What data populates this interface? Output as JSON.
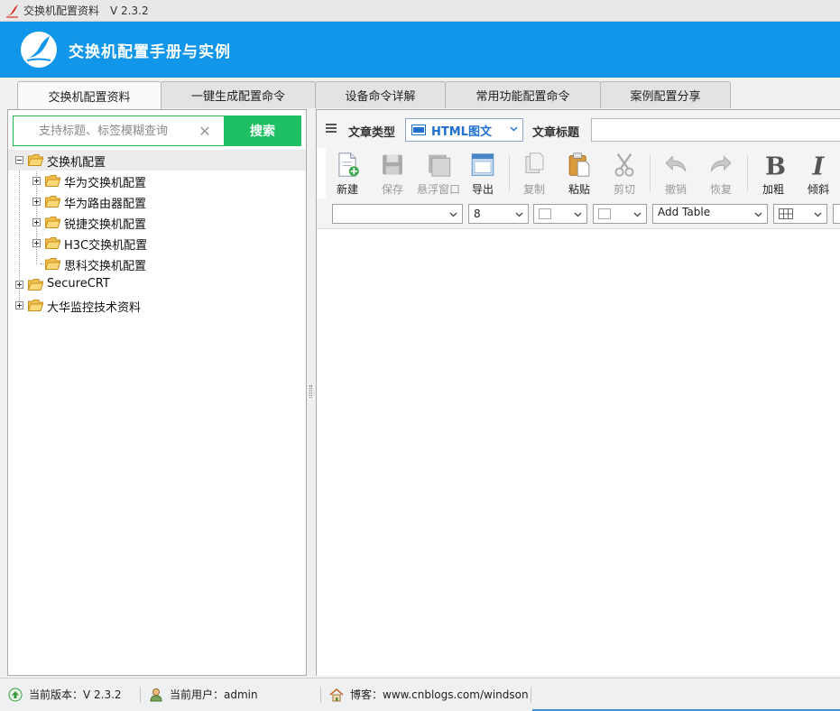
{
  "window": {
    "title": "交换机配置资料",
    "version": "V 2.3.2"
  },
  "banner": {
    "title": "交换机配置手册与实例"
  },
  "tabs": [
    {
      "label": "交换机配置资料",
      "active": true
    },
    {
      "label": "一键生成配置命令",
      "active": false
    },
    {
      "label": "设备命令详解",
      "active": false
    },
    {
      "label": "常用功能配置命令",
      "active": false
    },
    {
      "label": "案例配置分享",
      "active": false
    }
  ],
  "search": {
    "placeholder": "支持标题、标签模糊查询",
    "value": "",
    "button_label": "搜索"
  },
  "tree": {
    "root": "交换机配置",
    "children": [
      "华为交换机配置",
      "华为路由器配置",
      "锐捷交换机配置",
      "H3C交换机配置",
      "思科交换机配置"
    ],
    "others": [
      "SecureCRT",
      "大华监控技术资料"
    ]
  },
  "editor": {
    "type_label": "文章类型",
    "type_value": "HTML图文",
    "title_label": "文章标题",
    "title_value": "",
    "toolbar": [
      {
        "label": "新建",
        "icon": "new-document-icon",
        "enabled": true
      },
      {
        "label": "保存",
        "icon": "save-icon",
        "enabled": false
      },
      {
        "label": "悬浮窗口",
        "icon": "float-window-icon",
        "enabled": false
      },
      {
        "label": "导出",
        "icon": "export-icon",
        "enabled": true
      },
      {
        "label": "复制",
        "icon": "copy-icon",
        "enabled": false
      },
      {
        "label": "粘贴",
        "icon": "paste-icon",
        "enabled": true
      },
      {
        "label": "剪切",
        "icon": "cut-icon",
        "enabled": false
      },
      {
        "label": "撤销",
        "icon": "undo-icon",
        "enabled": false
      },
      {
        "label": "恢复",
        "icon": "redo-icon",
        "enabled": false
      },
      {
        "label": "加粗",
        "icon": "bold-icon",
        "enabled": true
      },
      {
        "label": "倾斜",
        "icon": "italic-icon",
        "enabled": true
      }
    ],
    "format": {
      "font_family": "",
      "font_size": "8",
      "add_table": "Add Table"
    }
  },
  "status": {
    "version": "当前版本：V 2.3.2",
    "user": "当前用户：admin",
    "blog": "博客：www.cnblogs.com/windson"
  },
  "colors": {
    "banner": "#1296e9",
    "search_button": "#1fc064",
    "accent_blue": "#1e6fd0"
  }
}
